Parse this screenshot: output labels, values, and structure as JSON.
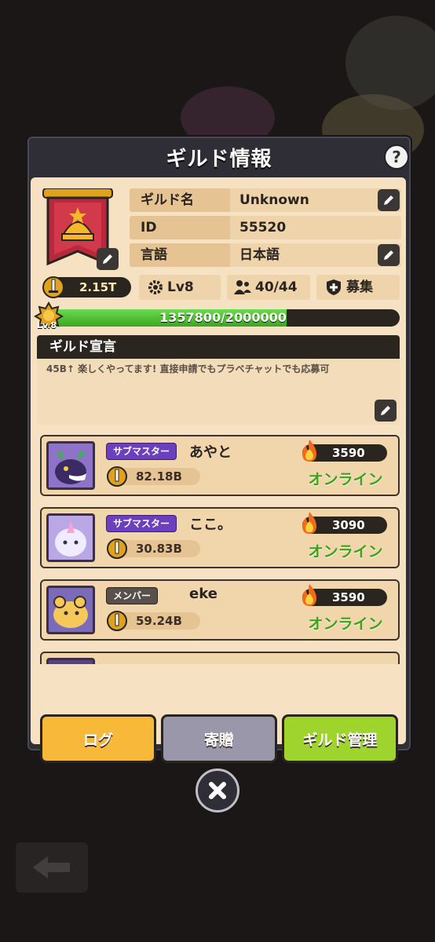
{
  "dialog": {
    "title": "ギルド情報",
    "help_label": "?"
  },
  "guild": {
    "name_label": "ギルド名",
    "name_value": "Unknown",
    "id_label": "ID",
    "id_value": "55520",
    "language_label": "言語",
    "language_value": "日本語",
    "power": "2.15T",
    "level": "Lv8",
    "members": "40/44",
    "recruit_label": "募集",
    "exp_text": "1357800/2000000",
    "exp_progress": 0.6789,
    "badge_level": "Lv.8",
    "declaration_title": "ギルド宣言",
    "declaration_text": "45B↑ 楽しくやってます! 直接申請でもプラベチャットでも応募可"
  },
  "members": [
    {
      "role": "サブマスター",
      "name": "あやと",
      "power": "82.18B",
      "fire": "3590",
      "status": "オンライン"
    },
    {
      "role": "サブマスター",
      "name": "ここ。",
      "power": "30.83B",
      "fire": "3090",
      "status": "オンライン"
    },
    {
      "role": "メンバー",
      "name": "eke",
      "power": "59.24B",
      "fire": "3590",
      "status": "オンライン"
    }
  ],
  "buttons": {
    "log": "ログ",
    "donate": "寄贈",
    "manage": "ギルド管理"
  },
  "colors": {
    "online": "#3ea11b",
    "sub_master": "#6b3fbd",
    "log_btn": "#f8b83a",
    "donate_btn": "#9a97aa",
    "manage_btn": "#9fd42e"
  }
}
